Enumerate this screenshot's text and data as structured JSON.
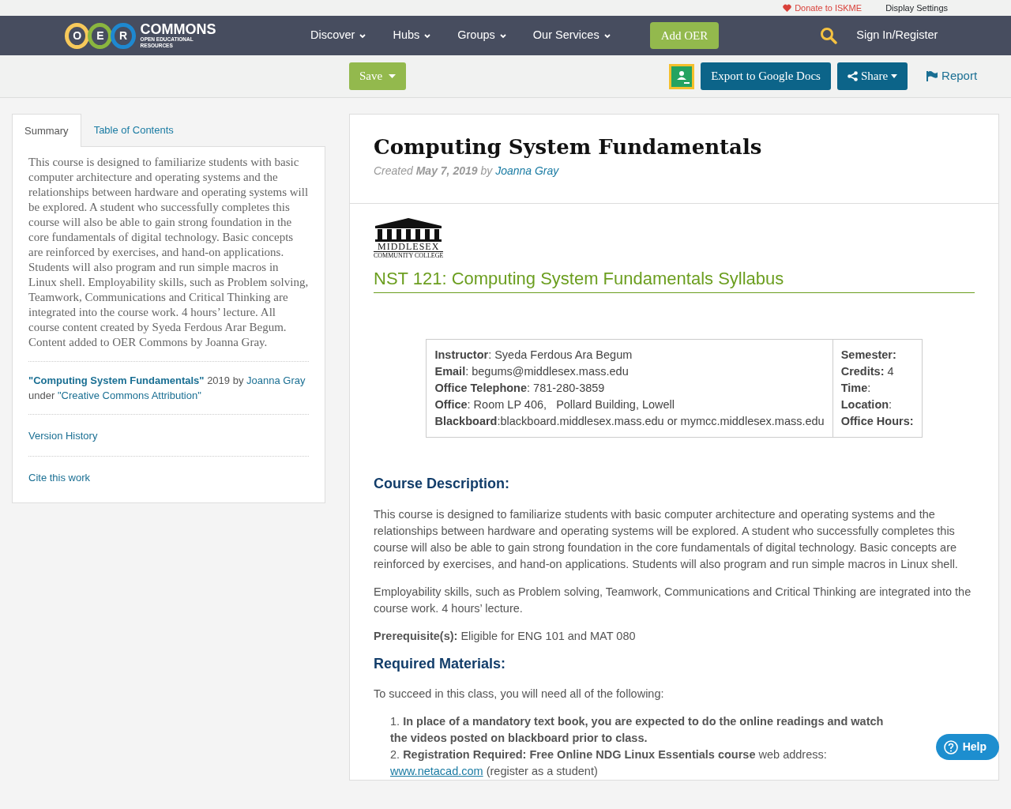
{
  "utility_bar": {
    "donate": "Donate to ISKME",
    "display_settings": "Display Settings"
  },
  "navbar": {
    "logo": {
      "letters": [
        "O",
        "E",
        "R"
      ],
      "name": "COMMONS",
      "tagline": "OPEN EDUCATIONAL RESOURCES"
    },
    "menu": [
      {
        "label": "Discover"
      },
      {
        "label": "Hubs"
      },
      {
        "label": "Groups"
      },
      {
        "label": "Our Services"
      }
    ],
    "add_button": "Add OER",
    "sign_in": "Sign In/Register"
  },
  "toolbar": {
    "save": "Save",
    "export": "Export to Google Docs",
    "share": "Share",
    "report": "Report"
  },
  "sidebar": {
    "tabs": [
      {
        "label": "Summary",
        "selected": true
      },
      {
        "label": "Table of Contents",
        "selected": false
      }
    ],
    "summary": "This course is designed to familiarize students with basic computer architecture and operating systems and the relationships between hardware and operating systems will be explored. A student who successfully completes this course will also be able to gain strong foundation in the core fundamentals of digital technology. Basic concepts are reinforced by exercises, and hand-on applications. Students will also program and run simple macros in Linux shell. Employability skills, such as Problem solving, Teamwork, Communications and Critical Thinking are integrated into the course work. 4 hours’ lecture. All course content created by Syeda Ferdous Arar Begum. Content added to OER Commons by Joanna Gray.",
    "attribution": {
      "title": "\"Computing System Fundamentals\"",
      "year_by": "2019 by",
      "author": "Joanna Gray",
      "under": "under",
      "license": "\"Creative Commons Attribution\""
    },
    "links": [
      "Version History",
      "Cite this work"
    ]
  },
  "resource": {
    "title": "Computing System Fundamentals",
    "created": {
      "prefix": "Created",
      "date": "May 7, 2019",
      "by": "by",
      "author": "Joanna Gray"
    },
    "college_logo": {
      "name": "MIDDLESEX",
      "subtitle": "COMMUNITY COLLEGE"
    },
    "syllabus_title": "NST 121: Computing System Fundamentals Syllabus",
    "info_table": {
      "left": [
        "**Instructor**: Syeda Ferdous Ara Begum",
        "**Email**: begums@middlesex.mass.edu",
        "**Office Telephone**: 781-280-3859",
        "**Office**: Room LP 406,   Pollard Building, Lowell",
        "**Blackboard**:blackboard.middlesex.mass.edu or mymcc.middlesex.mass.edu"
      ],
      "right": [
        "**Semester:**",
        "**Credits:** 4",
        "**Time**:",
        "**Location**:",
        "**Office Hours:**"
      ]
    },
    "sections": [
      {
        "kind": "heading",
        "text": "Course Description:"
      },
      {
        "kind": "paragraph",
        "text": "This course is designed to familiarize students with basic computer architecture and operating systems and the relationships between hardware and operating systems will be explored. A student who successfully completes this course will also be able to gain strong foundation in the core fundamentals of digital technology. Basic concepts are reinforced by exercises, and hand-on applications. Students will also program and run simple macros in Linux shell."
      },
      {
        "kind": "paragraph",
        "text": "Employability skills, such as Problem solving, Teamwork, Communications and Critical Thinking are integrated into the course work. 4 hours’ lecture."
      },
      {
        "kind": "paragraph",
        "text": "**Prerequisite(s):** Eligible for ENG 101 and MAT 080"
      },
      {
        "kind": "heading",
        "text": "Required Materials:"
      },
      {
        "kind": "paragraph",
        "text": "To succeed in this class, you will need all of the following:"
      },
      {
        "kind": "list",
        "items": [
          {
            "number": "1.",
            "lead": "In place of a mandatory text book, you are expected to do the online readings and watch the videos posted on blackboard prior to class."
          },
          {
            "number": "2.",
            "lead": "Registration Required: Free Online NDG Linux Essentials course",
            "text": "web address:",
            "link": "www.netacad.com",
            "tail": "(register as a student)"
          }
        ]
      }
    ]
  },
  "help_button": "Help"
}
